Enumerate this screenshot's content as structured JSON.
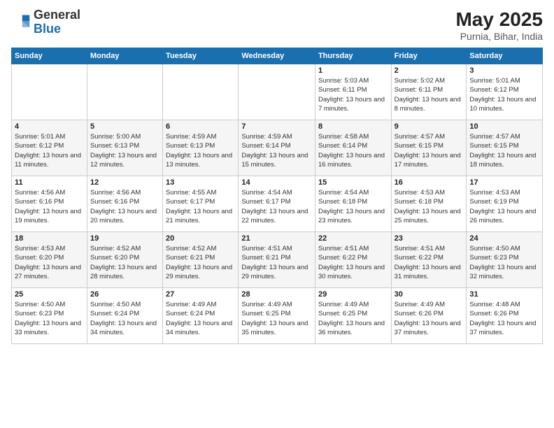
{
  "logo": {
    "general": "General",
    "blue": "Blue"
  },
  "title": {
    "month_year": "May 2025",
    "location": "Purnia, Bihar, India"
  },
  "weekdays": [
    "Sunday",
    "Monday",
    "Tuesday",
    "Wednesday",
    "Thursday",
    "Friday",
    "Saturday"
  ],
  "weeks": [
    [
      {
        "day": "",
        "sunrise": "",
        "sunset": "",
        "daylight": ""
      },
      {
        "day": "",
        "sunrise": "",
        "sunset": "",
        "daylight": ""
      },
      {
        "day": "",
        "sunrise": "",
        "sunset": "",
        "daylight": ""
      },
      {
        "day": "",
        "sunrise": "",
        "sunset": "",
        "daylight": ""
      },
      {
        "day": "1",
        "sunrise": "Sunrise: 5:03 AM",
        "sunset": "Sunset: 6:11 PM",
        "daylight": "Daylight: 13 hours and 7 minutes."
      },
      {
        "day": "2",
        "sunrise": "Sunrise: 5:02 AM",
        "sunset": "Sunset: 6:11 PM",
        "daylight": "Daylight: 13 hours and 8 minutes."
      },
      {
        "day": "3",
        "sunrise": "Sunrise: 5:01 AM",
        "sunset": "Sunset: 6:12 PM",
        "daylight": "Daylight: 13 hours and 10 minutes."
      }
    ],
    [
      {
        "day": "4",
        "sunrise": "Sunrise: 5:01 AM",
        "sunset": "Sunset: 6:12 PM",
        "daylight": "Daylight: 13 hours and 11 minutes."
      },
      {
        "day": "5",
        "sunrise": "Sunrise: 5:00 AM",
        "sunset": "Sunset: 6:13 PM",
        "daylight": "Daylight: 13 hours and 12 minutes."
      },
      {
        "day": "6",
        "sunrise": "Sunrise: 4:59 AM",
        "sunset": "Sunset: 6:13 PM",
        "daylight": "Daylight: 13 hours and 13 minutes."
      },
      {
        "day": "7",
        "sunrise": "Sunrise: 4:59 AM",
        "sunset": "Sunset: 6:14 PM",
        "daylight": "Daylight: 13 hours and 15 minutes."
      },
      {
        "day": "8",
        "sunrise": "Sunrise: 4:58 AM",
        "sunset": "Sunset: 6:14 PM",
        "daylight": "Daylight: 13 hours and 16 minutes."
      },
      {
        "day": "9",
        "sunrise": "Sunrise: 4:57 AM",
        "sunset": "Sunset: 6:15 PM",
        "daylight": "Daylight: 13 hours and 17 minutes."
      },
      {
        "day": "10",
        "sunrise": "Sunrise: 4:57 AM",
        "sunset": "Sunset: 6:15 PM",
        "daylight": "Daylight: 13 hours and 18 minutes."
      }
    ],
    [
      {
        "day": "11",
        "sunrise": "Sunrise: 4:56 AM",
        "sunset": "Sunset: 6:16 PM",
        "daylight": "Daylight: 13 hours and 19 minutes."
      },
      {
        "day": "12",
        "sunrise": "Sunrise: 4:56 AM",
        "sunset": "Sunset: 6:16 PM",
        "daylight": "Daylight: 13 hours and 20 minutes."
      },
      {
        "day": "13",
        "sunrise": "Sunrise: 4:55 AM",
        "sunset": "Sunset: 6:17 PM",
        "daylight": "Daylight: 13 hours and 21 minutes."
      },
      {
        "day": "14",
        "sunrise": "Sunrise: 4:54 AM",
        "sunset": "Sunset: 6:17 PM",
        "daylight": "Daylight: 13 hours and 22 minutes."
      },
      {
        "day": "15",
        "sunrise": "Sunrise: 4:54 AM",
        "sunset": "Sunset: 6:18 PM",
        "daylight": "Daylight: 13 hours and 23 minutes."
      },
      {
        "day": "16",
        "sunrise": "Sunrise: 4:53 AM",
        "sunset": "Sunset: 6:18 PM",
        "daylight": "Daylight: 13 hours and 25 minutes."
      },
      {
        "day": "17",
        "sunrise": "Sunrise: 4:53 AM",
        "sunset": "Sunset: 6:19 PM",
        "daylight": "Daylight: 13 hours and 26 minutes."
      }
    ],
    [
      {
        "day": "18",
        "sunrise": "Sunrise: 4:53 AM",
        "sunset": "Sunset: 6:20 PM",
        "daylight": "Daylight: 13 hours and 27 minutes."
      },
      {
        "day": "19",
        "sunrise": "Sunrise: 4:52 AM",
        "sunset": "Sunset: 6:20 PM",
        "daylight": "Daylight: 13 hours and 28 minutes."
      },
      {
        "day": "20",
        "sunrise": "Sunrise: 4:52 AM",
        "sunset": "Sunset: 6:21 PM",
        "daylight": "Daylight: 13 hours and 29 minutes."
      },
      {
        "day": "21",
        "sunrise": "Sunrise: 4:51 AM",
        "sunset": "Sunset: 6:21 PM",
        "daylight": "Daylight: 13 hours and 29 minutes."
      },
      {
        "day": "22",
        "sunrise": "Sunrise: 4:51 AM",
        "sunset": "Sunset: 6:22 PM",
        "daylight": "Daylight: 13 hours and 30 minutes."
      },
      {
        "day": "23",
        "sunrise": "Sunrise: 4:51 AM",
        "sunset": "Sunset: 6:22 PM",
        "daylight": "Daylight: 13 hours and 31 minutes."
      },
      {
        "day": "24",
        "sunrise": "Sunrise: 4:50 AM",
        "sunset": "Sunset: 6:23 PM",
        "daylight": "Daylight: 13 hours and 32 minutes."
      }
    ],
    [
      {
        "day": "25",
        "sunrise": "Sunrise: 4:50 AM",
        "sunset": "Sunset: 6:23 PM",
        "daylight": "Daylight: 13 hours and 33 minutes."
      },
      {
        "day": "26",
        "sunrise": "Sunrise: 4:50 AM",
        "sunset": "Sunset: 6:24 PM",
        "daylight": "Daylight: 13 hours and 34 minutes."
      },
      {
        "day": "27",
        "sunrise": "Sunrise: 4:49 AM",
        "sunset": "Sunset: 6:24 PM",
        "daylight": "Daylight: 13 hours and 34 minutes."
      },
      {
        "day": "28",
        "sunrise": "Sunrise: 4:49 AM",
        "sunset": "Sunset: 6:25 PM",
        "daylight": "Daylight: 13 hours and 35 minutes."
      },
      {
        "day": "29",
        "sunrise": "Sunrise: 4:49 AM",
        "sunset": "Sunset: 6:25 PM",
        "daylight": "Daylight: 13 hours and 36 minutes."
      },
      {
        "day": "30",
        "sunrise": "Sunrise: 4:49 AM",
        "sunset": "Sunset: 6:26 PM",
        "daylight": "Daylight: 13 hours and 37 minutes."
      },
      {
        "day": "31",
        "sunrise": "Sunrise: 4:48 AM",
        "sunset": "Sunset: 6:26 PM",
        "daylight": "Daylight: 13 hours and 37 minutes."
      }
    ]
  ]
}
